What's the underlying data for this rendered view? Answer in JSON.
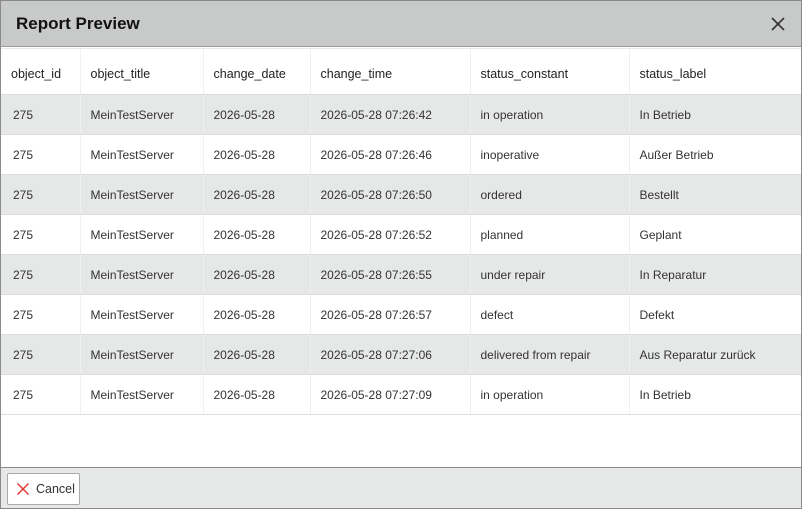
{
  "dialog": {
    "title": "Report Preview",
    "cancel_label": "Cancel"
  },
  "table": {
    "columns": [
      "object_id",
      "object_title",
      "change_date",
      "change_time",
      "status_constant",
      "status_label"
    ],
    "rows": [
      [
        "275",
        "MeinTestServer",
        "2026-05-28",
        "2026-05-28 07:26:42",
        "in operation",
        "In Betrieb"
      ],
      [
        "275",
        "MeinTestServer",
        "2026-05-28",
        "2026-05-28 07:26:46",
        "inoperative",
        "Außer Betrieb"
      ],
      [
        "275",
        "MeinTestServer",
        "2026-05-28",
        "2026-05-28 07:26:50",
        "ordered",
        "Bestellt"
      ],
      [
        "275",
        "MeinTestServer",
        "2026-05-28",
        "2026-05-28 07:26:52",
        "planned",
        "Geplant"
      ],
      [
        "275",
        "MeinTestServer",
        "2026-05-28",
        "2026-05-28 07:26:55",
        "under repair",
        "In Reparatur"
      ],
      [
        "275",
        "MeinTestServer",
        "2026-05-28",
        "2026-05-28 07:26:57",
        "defect",
        "Defekt"
      ],
      [
        "275",
        "MeinTestServer",
        "2026-05-28",
        "2026-05-28 07:27:06",
        "delivered from repair",
        "Aus Reparatur zurück"
      ],
      [
        "275",
        "MeinTestServer",
        "2026-05-28",
        "2026-05-28 07:27:09",
        "in operation",
        "In Betrieb"
      ]
    ]
  },
  "colors": {
    "header_bg": "#c8c9c9",
    "row_alt_bg": "#e6e7e7",
    "cancel_icon": "#e53935"
  },
  "icons": {
    "close": "close-icon",
    "cancel": "cancel-x-icon"
  }
}
